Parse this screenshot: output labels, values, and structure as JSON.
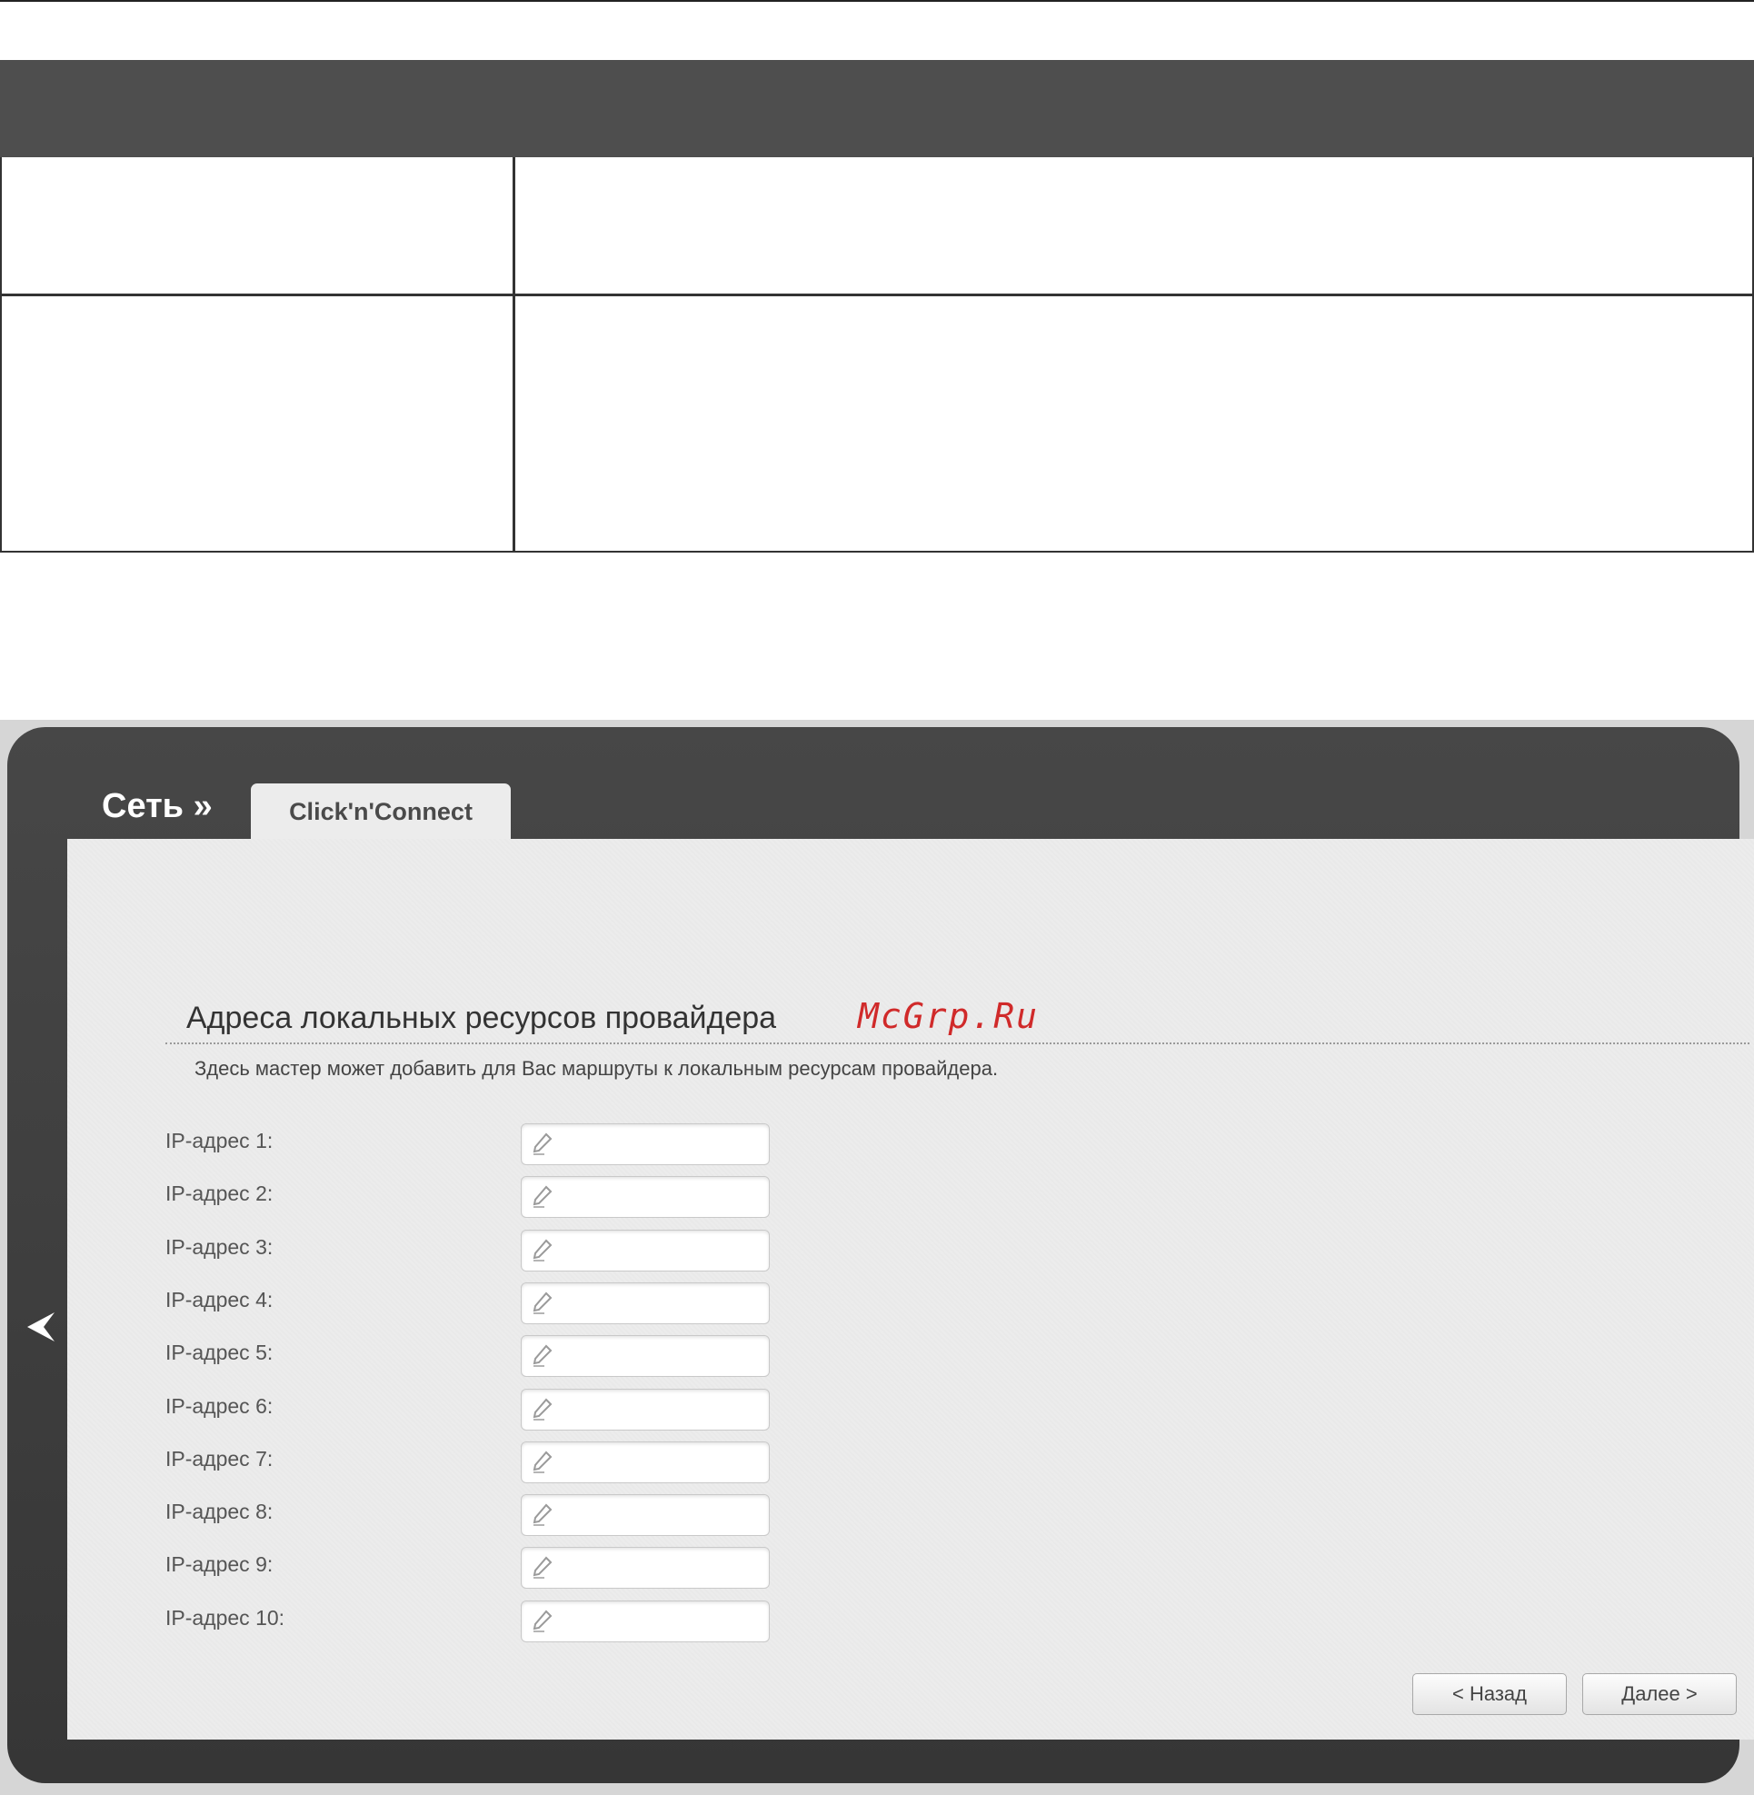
{
  "breadcrumb": {
    "root": "Сеть »",
    "tab": "Click'n'Connect"
  },
  "section": {
    "title": "Адреса локальных ресурсов провайдера",
    "watermark": "McGrp.Ru",
    "description": "Здесь мастер может добавить для Вас маршруты к локальным ресурсам провайдера."
  },
  "fields": [
    {
      "label": "IP-адрес 1:",
      "value": ""
    },
    {
      "label": "IP-адрес 2:",
      "value": ""
    },
    {
      "label": "IP-адрес 3:",
      "value": ""
    },
    {
      "label": "IP-адрес 4:",
      "value": ""
    },
    {
      "label": "IP-адрес 5:",
      "value": ""
    },
    {
      "label": "IP-адрес 6:",
      "value": ""
    },
    {
      "label": "IP-адрес 7:",
      "value": ""
    },
    {
      "label": "IP-адрес 8:",
      "value": ""
    },
    {
      "label": "IP-адрес 9:",
      "value": ""
    },
    {
      "label": "IP-адрес 10:",
      "value": ""
    }
  ],
  "buttons": {
    "back": "< Назад",
    "next": "Далее >"
  },
  "icons": {
    "side": "chevron-left-icon",
    "field": "pencil-icon"
  },
  "colors": {
    "frame": "#3c3c3c",
    "content": "#ececec",
    "watermark": "#d02a2a",
    "doc_header": "#4e4e4e"
  }
}
